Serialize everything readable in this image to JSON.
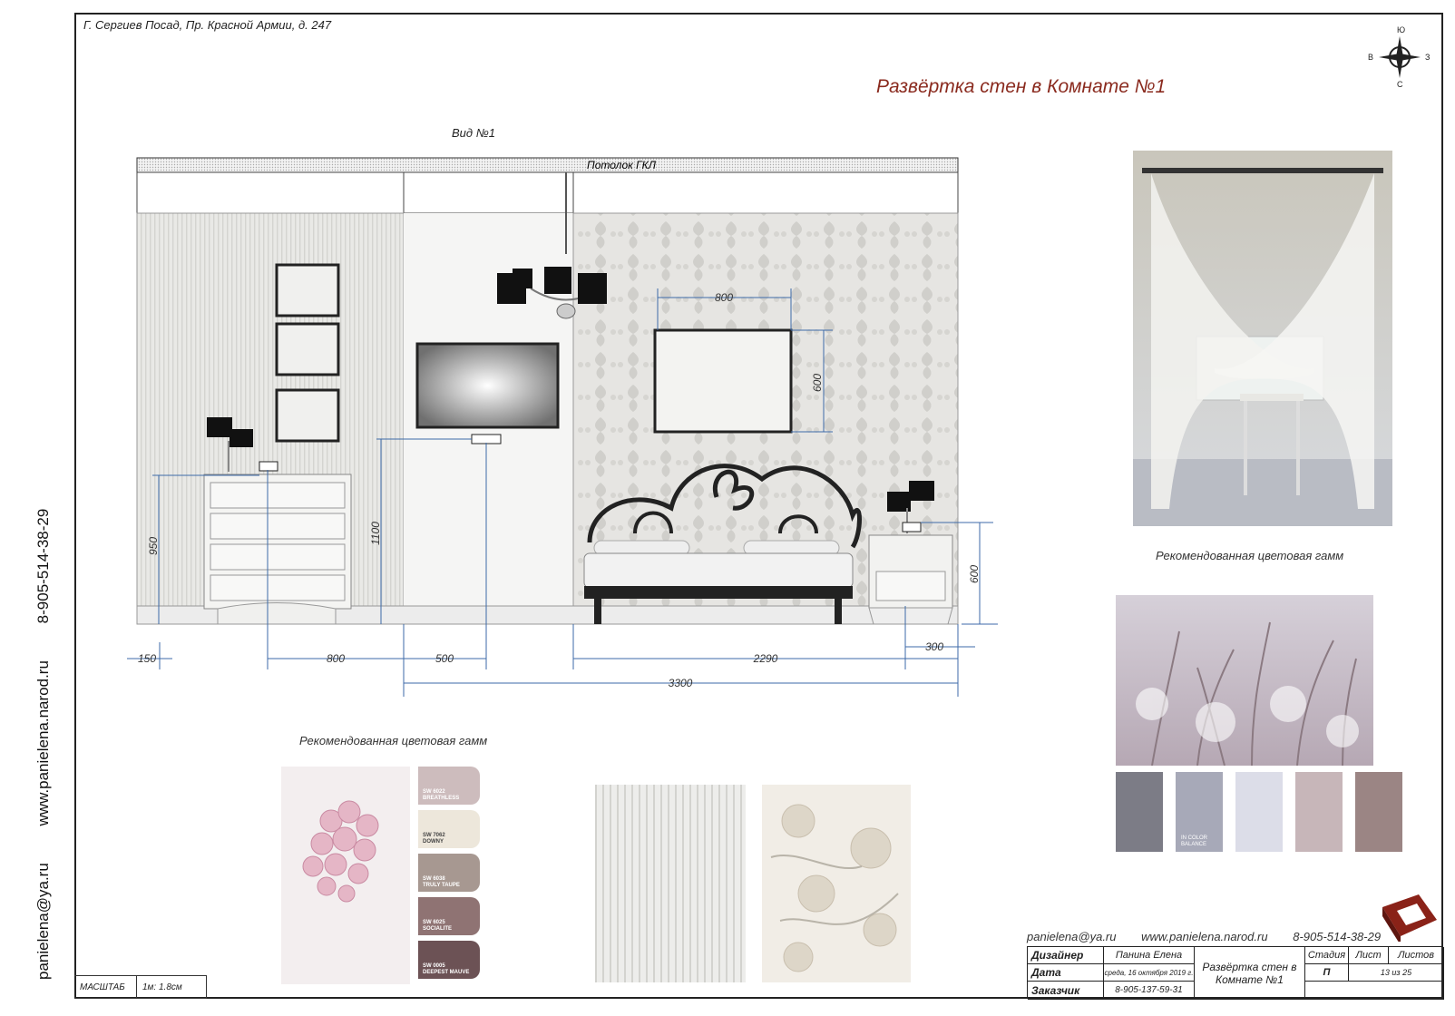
{
  "address": "Г. Сергиев Посад, Пр. Красной Армии, д. 247",
  "sheet_title": "Развёртка стен в Комнате №1",
  "view_title": "Вид №1",
  "compass": {
    "n": "Ю",
    "s": "С",
    "w": "В",
    "e": "З"
  },
  "side_contacts": {
    "email": "panielena@ya.ru",
    "site": "www.panielena.narod.ru",
    "phone": "8-905-514-38-29"
  },
  "ceiling_label": "Потолок ГКЛ",
  "dimensions": {
    "frame_w": "800",
    "frame_h": "600",
    "v950": "950",
    "v1100": "1100",
    "v600": "600",
    "h150": "150",
    "h800": "800",
    "h500": "500",
    "h2290": "2290",
    "h300": "300",
    "h3300": "3300"
  },
  "recommended_label_1": "Рекомендованная цветовая гамм",
  "recommended_label_2": "Рекомендованная цветовая гамм",
  "paint_chips": [
    {
      "code": "SW 6022",
      "name": "BREATHLESS",
      "color": "#cdbcbd"
    },
    {
      "code": "SW 7062",
      "name": "DOWNY",
      "color": "#ede7db"
    },
    {
      "code": "SW 6038",
      "name": "TRULY TAUPE",
      "color": "#a79891"
    },
    {
      "code": "SW 6025",
      "name": "SOCIALITE",
      "color": "#8f7373"
    },
    {
      "code": "SW 0005",
      "name": "DEEPEST MAUVE",
      "color": "#6c5255"
    }
  ],
  "palette": [
    {
      "color": "#7c7c86",
      "caption": ""
    },
    {
      "color": "#a7a9b8",
      "caption": "IN COLOR BALANCE"
    },
    {
      "color": "#dcdde8",
      "caption": ""
    },
    {
      "color": "#c7b6b9",
      "caption": ""
    },
    {
      "color": "#9b8584",
      "caption": ""
    }
  ],
  "scale": {
    "label": "МАСШТАБ",
    "value": "1м: 1.8см"
  },
  "footer_contacts": {
    "email": "panielena@ya.ru",
    "site": "www.panielena.narod.ru",
    "phone": "8-905-514-38-29"
  },
  "stamp": {
    "designer_label": "Дизайнер",
    "designer": "Панина Елена",
    "date_label": "Дата",
    "date": "среда, 16 октября 2019 г.",
    "client_label": "Заказчик",
    "client_phone": "8-905-137-59-31",
    "title": "Развёртка стен в Комнате №1",
    "stage_label": "Стадия",
    "stage": "П",
    "sheet_label": "Лист",
    "sheets_label": "Листов",
    "sheet_of": "13 из 25"
  }
}
